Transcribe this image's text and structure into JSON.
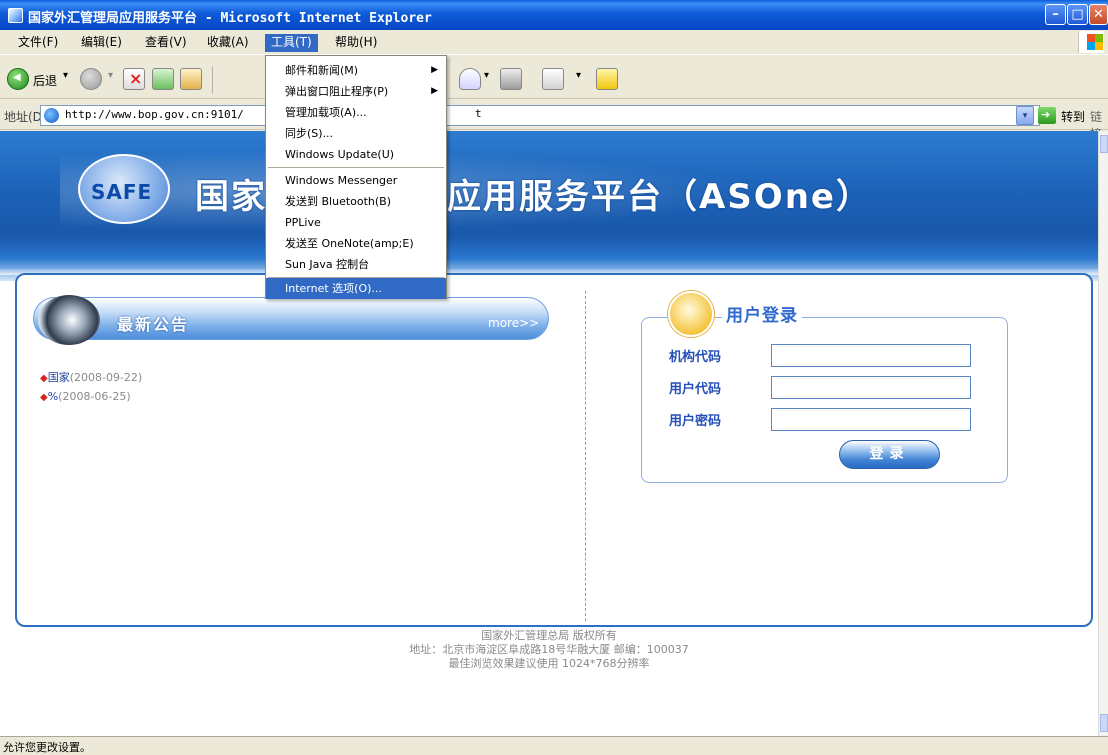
{
  "window": {
    "title": "国家外汇管理局应用服务平台 - Microsoft Internet Explorer",
    "min": "–",
    "max": "□",
    "close": "✕"
  },
  "menubar": {
    "items": [
      "文件(F)",
      "编辑(E)",
      "查看(V)",
      "收藏(A)",
      "工具(T)",
      "帮助(H)"
    ],
    "active": "工具(T)"
  },
  "toolbar": {
    "back_label": "后退",
    "dropdown": "▾"
  },
  "address": {
    "label": "地址(D)",
    "url": "http://www.bop.gov.cn:9101/",
    "url_tail": "t",
    "go_label": "转到",
    "links_label": "链接"
  },
  "tools_menu": {
    "items": [
      {
        "label": "邮件和新闻(M)",
        "submenu": true
      },
      {
        "label": "弹出窗口阻止程序(P)",
        "submenu": true
      },
      {
        "label": "管理加载项(A)...",
        "submenu": false
      },
      {
        "label": "同步(S)...",
        "submenu": false
      },
      {
        "label": "Windows Update(U)",
        "submenu": false
      },
      {
        "label": "Windows Messenger",
        "submenu": false
      },
      {
        "label": "发送到 Bluetooth(B)",
        "submenu": false
      },
      {
        "label": "PPLive",
        "submenu": false
      },
      {
        "label": "发送至 OneNote(amp;E)",
        "submenu": false
      },
      {
        "label": "Sun Java 控制台",
        "submenu": false
      },
      {
        "label": "Internet 选项(O)...",
        "submenu": false,
        "selected": true
      }
    ],
    "arrow": "▶"
  },
  "page": {
    "banner": {
      "logo_text": "SAFE",
      "title": "国家外汇管理局应用服务平台（ASOne）"
    },
    "news": {
      "title": "最新公告",
      "more": "more>>",
      "bullet": "◆",
      "items": [
        {
          "title": "国家",
          "date": "(2008-09-22)"
        },
        {
          "title": "%",
          "date": "(2008-06-25)"
        }
      ]
    },
    "login": {
      "title": "用户登录",
      "fields": [
        {
          "label": "机构代码",
          "value": ""
        },
        {
          "label": "用户代码",
          "value": ""
        },
        {
          "label": "用户密码",
          "value": ""
        }
      ],
      "button": "登录"
    },
    "footer": [
      "国家外汇管理总局 版权所有",
      "地址：北京市海淀区阜成路18号华融大厦 邮编：100037",
      "最佳浏览效果建议使用 1024*768分辨率"
    ]
  },
  "status": {
    "text": "允许您更改设置。"
  }
}
